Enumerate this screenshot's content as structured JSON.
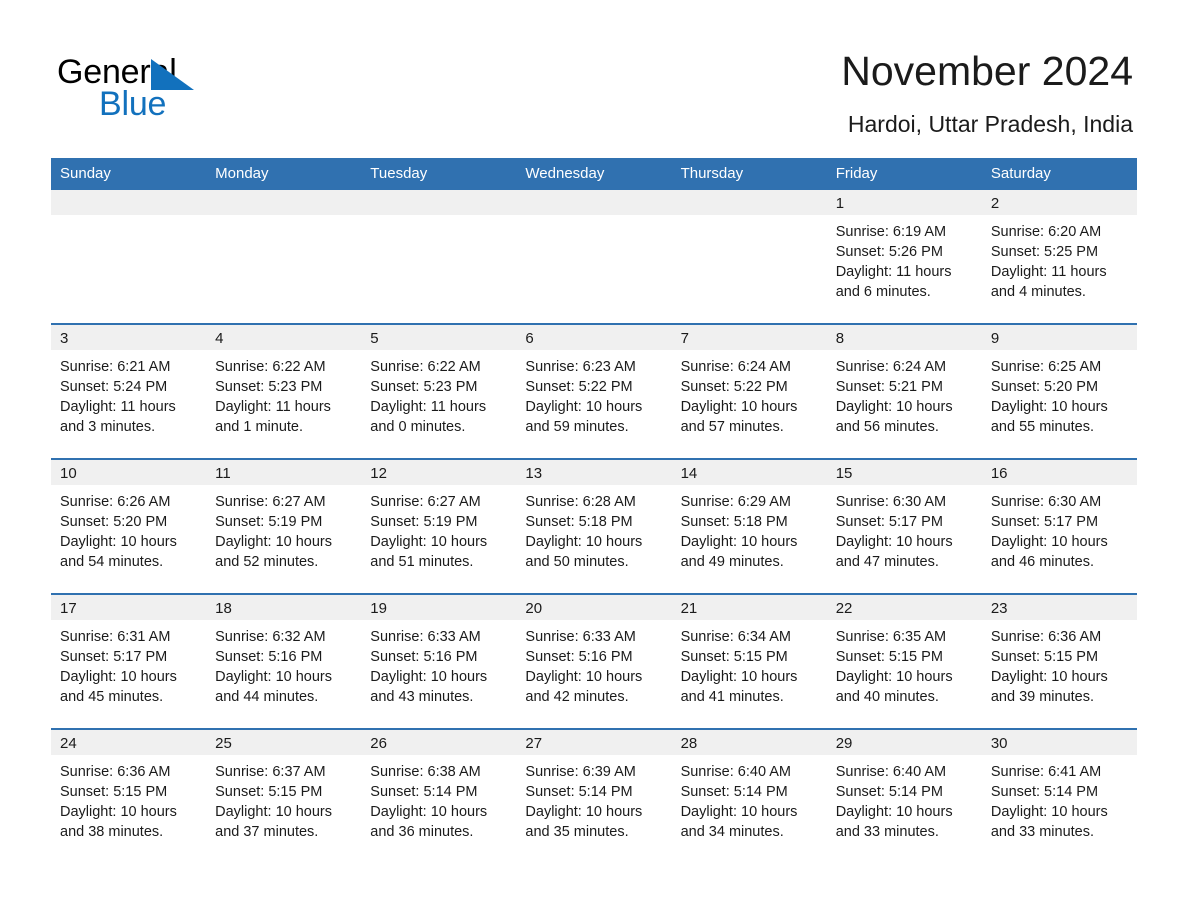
{
  "brand": {
    "logo_line1": "General",
    "logo_line2": "Blue",
    "triangle_color": "#1271bd"
  },
  "header": {
    "title": "November 2024",
    "subtitle": "Hardoi, Uttar Pradesh, India"
  },
  "theme": {
    "header_blue": "#3071b0",
    "row_separator_blue": "#3071b0",
    "daynum_band_gray": "#f0f0f0",
    "text_color": "#1b1b1b"
  },
  "weekday_headers": [
    "Sunday",
    "Monday",
    "Tuesday",
    "Wednesday",
    "Thursday",
    "Friday",
    "Saturday"
  ],
  "weeks": [
    [
      {
        "day": "",
        "lines": []
      },
      {
        "day": "",
        "lines": []
      },
      {
        "day": "",
        "lines": []
      },
      {
        "day": "",
        "lines": []
      },
      {
        "day": "",
        "lines": []
      },
      {
        "day": "1",
        "lines": [
          "Sunrise: 6:19 AM",
          "Sunset: 5:26 PM",
          "Daylight: 11 hours",
          "and 6 minutes."
        ]
      },
      {
        "day": "2",
        "lines": [
          "Sunrise: 6:20 AM",
          "Sunset: 5:25 PM",
          "Daylight: 11 hours",
          "and 4 minutes."
        ]
      }
    ],
    [
      {
        "day": "3",
        "lines": [
          "Sunrise: 6:21 AM",
          "Sunset: 5:24 PM",
          "Daylight: 11 hours",
          "and 3 minutes."
        ]
      },
      {
        "day": "4",
        "lines": [
          "Sunrise: 6:22 AM",
          "Sunset: 5:23 PM",
          "Daylight: 11 hours",
          "and 1 minute."
        ]
      },
      {
        "day": "5",
        "lines": [
          "Sunrise: 6:22 AM",
          "Sunset: 5:23 PM",
          "Daylight: 11 hours",
          "and 0 minutes."
        ]
      },
      {
        "day": "6",
        "lines": [
          "Sunrise: 6:23 AM",
          "Sunset: 5:22 PM",
          "Daylight: 10 hours",
          "and 59 minutes."
        ]
      },
      {
        "day": "7",
        "lines": [
          "Sunrise: 6:24 AM",
          "Sunset: 5:22 PM",
          "Daylight: 10 hours",
          "and 57 minutes."
        ]
      },
      {
        "day": "8",
        "lines": [
          "Sunrise: 6:24 AM",
          "Sunset: 5:21 PM",
          "Daylight: 10 hours",
          "and 56 minutes."
        ]
      },
      {
        "day": "9",
        "lines": [
          "Sunrise: 6:25 AM",
          "Sunset: 5:20 PM",
          "Daylight: 10 hours",
          "and 55 minutes."
        ]
      }
    ],
    [
      {
        "day": "10",
        "lines": [
          "Sunrise: 6:26 AM",
          "Sunset: 5:20 PM",
          "Daylight: 10 hours",
          "and 54 minutes."
        ]
      },
      {
        "day": "11",
        "lines": [
          "Sunrise: 6:27 AM",
          "Sunset: 5:19 PM",
          "Daylight: 10 hours",
          "and 52 minutes."
        ]
      },
      {
        "day": "12",
        "lines": [
          "Sunrise: 6:27 AM",
          "Sunset: 5:19 PM",
          "Daylight: 10 hours",
          "and 51 minutes."
        ]
      },
      {
        "day": "13",
        "lines": [
          "Sunrise: 6:28 AM",
          "Sunset: 5:18 PM",
          "Daylight: 10 hours",
          "and 50 minutes."
        ]
      },
      {
        "day": "14",
        "lines": [
          "Sunrise: 6:29 AM",
          "Sunset: 5:18 PM",
          "Daylight: 10 hours",
          "and 49 minutes."
        ]
      },
      {
        "day": "15",
        "lines": [
          "Sunrise: 6:30 AM",
          "Sunset: 5:17 PM",
          "Daylight: 10 hours",
          "and 47 minutes."
        ]
      },
      {
        "day": "16",
        "lines": [
          "Sunrise: 6:30 AM",
          "Sunset: 5:17 PM",
          "Daylight: 10 hours",
          "and 46 minutes."
        ]
      }
    ],
    [
      {
        "day": "17",
        "lines": [
          "Sunrise: 6:31 AM",
          "Sunset: 5:17 PM",
          "Daylight: 10 hours",
          "and 45 minutes."
        ]
      },
      {
        "day": "18",
        "lines": [
          "Sunrise: 6:32 AM",
          "Sunset: 5:16 PM",
          "Daylight: 10 hours",
          "and 44 minutes."
        ]
      },
      {
        "day": "19",
        "lines": [
          "Sunrise: 6:33 AM",
          "Sunset: 5:16 PM",
          "Daylight: 10 hours",
          "and 43 minutes."
        ]
      },
      {
        "day": "20",
        "lines": [
          "Sunrise: 6:33 AM",
          "Sunset: 5:16 PM",
          "Daylight: 10 hours",
          "and 42 minutes."
        ]
      },
      {
        "day": "21",
        "lines": [
          "Sunrise: 6:34 AM",
          "Sunset: 5:15 PM",
          "Daylight: 10 hours",
          "and 41 minutes."
        ]
      },
      {
        "day": "22",
        "lines": [
          "Sunrise: 6:35 AM",
          "Sunset: 5:15 PM",
          "Daylight: 10 hours",
          "and 40 minutes."
        ]
      },
      {
        "day": "23",
        "lines": [
          "Sunrise: 6:36 AM",
          "Sunset: 5:15 PM",
          "Daylight: 10 hours",
          "and 39 minutes."
        ]
      }
    ],
    [
      {
        "day": "24",
        "lines": [
          "Sunrise: 6:36 AM",
          "Sunset: 5:15 PM",
          "Daylight: 10 hours",
          "and 38 minutes."
        ]
      },
      {
        "day": "25",
        "lines": [
          "Sunrise: 6:37 AM",
          "Sunset: 5:15 PM",
          "Daylight: 10 hours",
          "and 37 minutes."
        ]
      },
      {
        "day": "26",
        "lines": [
          "Sunrise: 6:38 AM",
          "Sunset: 5:14 PM",
          "Daylight: 10 hours",
          "and 36 minutes."
        ]
      },
      {
        "day": "27",
        "lines": [
          "Sunrise: 6:39 AM",
          "Sunset: 5:14 PM",
          "Daylight: 10 hours",
          "and 35 minutes."
        ]
      },
      {
        "day": "28",
        "lines": [
          "Sunrise: 6:40 AM",
          "Sunset: 5:14 PM",
          "Daylight: 10 hours",
          "and 34 minutes."
        ]
      },
      {
        "day": "29",
        "lines": [
          "Sunrise: 6:40 AM",
          "Sunset: 5:14 PM",
          "Daylight: 10 hours",
          "and 33 minutes."
        ]
      },
      {
        "day": "30",
        "lines": [
          "Sunrise: 6:41 AM",
          "Sunset: 5:14 PM",
          "Daylight: 10 hours",
          "and 33 minutes."
        ]
      }
    ]
  ]
}
